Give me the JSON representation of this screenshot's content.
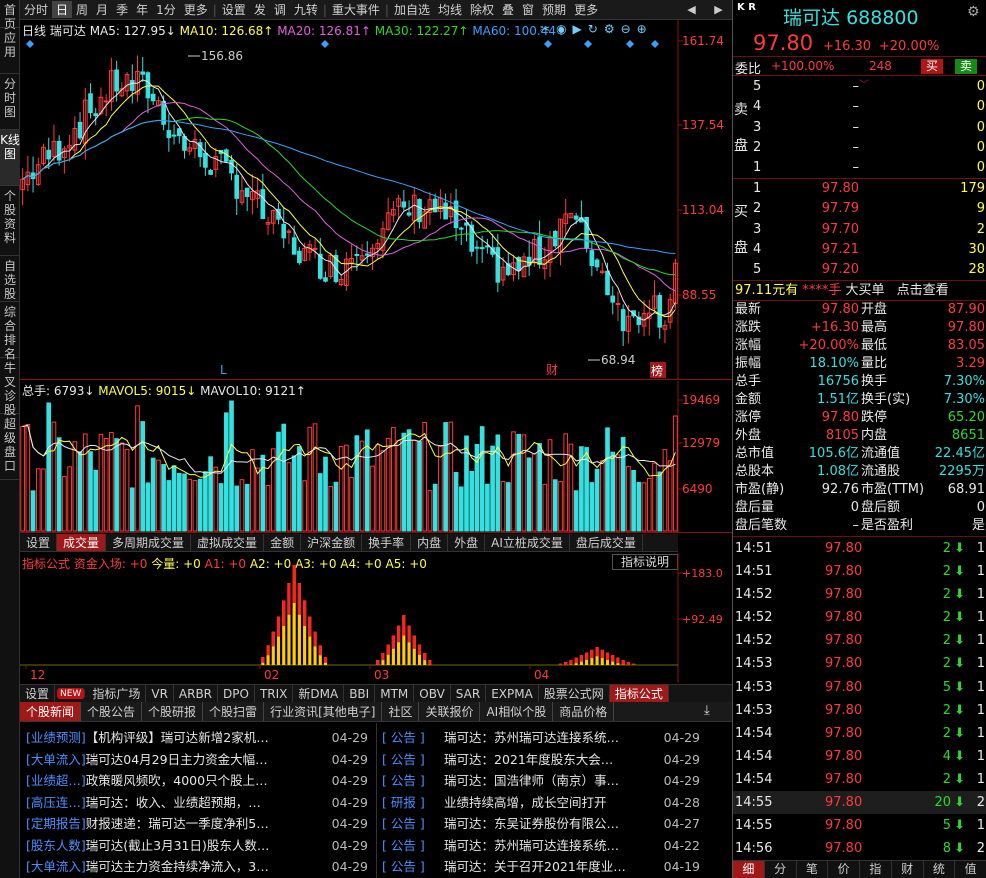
{
  "left_tabs": [
    "首页",
    "应用",
    "分时图",
    "K线图",
    "个股资料",
    "自选股",
    "综合排名",
    "牛叉诊股",
    "超级盘口"
  ],
  "left_active": "K线图",
  "toolbar": {
    "items": [
      "分时",
      "日",
      "周",
      "月",
      "季",
      "年",
      "1分",
      "更多",
      "设置",
      "发",
      "调",
      "九转",
      "重大事件",
      "加自选",
      "均线",
      "除权",
      "叠",
      "窗",
      "预期",
      "更多"
    ],
    "active": "日"
  },
  "kline": {
    "label_day": "日线",
    "name": "瑞可达",
    "ma5": "MA5: 127.95↓",
    "ma10": "MA10: 126.68↑",
    "ma20": "MA20: 126.81↑",
    "ma30": "MA30: 122.27↑",
    "ma60": "MA60: 100.44↑",
    "y_ticks": [
      "161.74",
      "137.54",
      "113.04",
      "88.55"
    ],
    "high_label": "156.86",
    "low_label": "68.94",
    "marker_L": "L",
    "marker_cai": "财",
    "marker_bang": "榜"
  },
  "volume": {
    "total": "总手: 6793↓",
    "mavol5": "MAVOL5: 9015↓",
    "mavol10": "MAVOL10: 9121↑",
    "y_ticks": [
      "19469",
      "12979",
      "6490"
    ]
  },
  "vol_tabs": [
    "设置",
    "成交量",
    "多周期成交量",
    "虚拟成交量",
    "金额",
    "沪深金额",
    "换手率",
    "内盘",
    "外盘",
    "AI立桩成交量",
    "盘后成交量"
  ],
  "vol_tabs_active": "成交量",
  "indicator": {
    "title": "指标公式",
    "formula": "资金入场: +0",
    "today": "今量: +0",
    "a1": "A1: +0",
    "a2": "A2: +0",
    "a3": "A3: +0",
    "a4": "A4: +0",
    "a5": "A5: +0",
    "help": "指标说明",
    "y_ticks": [
      "+183.0",
      "+92.49"
    ],
    "x_labels": [
      "12",
      "02",
      "03",
      "04"
    ]
  },
  "ind_tabs": [
    "设置",
    "NEW",
    "指标广场",
    "VR",
    "ARBR",
    "DPO",
    "TRIX",
    "新DMA",
    "BBI",
    "MTM",
    "OBV",
    "SAR",
    "EXPMA",
    "股票公式网",
    "指标公式"
  ],
  "ind_tabs_active": "指标公式",
  "news_tabs": [
    "个股新闻",
    "个股公告",
    "个股研报",
    "个股扫雷",
    "行业资讯[其他电子]",
    "社区",
    "关联报价",
    "AI相似个股",
    "商品价格"
  ],
  "news_tabs_active": "个股新闻",
  "news_left": [
    {
      "tag": "[业绩预测]",
      "title": "【机构评级】瑞可达新增2家机…",
      "date": "04-29"
    },
    {
      "tag": "[大单流入]",
      "title": "瑞可达04月29日主力资金大幅…",
      "date": "04-29"
    },
    {
      "tag": "[业绩超…]",
      "title": "政策暖风频吹，4000只个股上…",
      "date": "04-29"
    },
    {
      "tag": "[高压连…]",
      "title": "瑞可达：收入、业绩超预期，…",
      "date": "04-29"
    },
    {
      "tag": "[定期报告]",
      "title": "财报速递：瑞可达一季度净利5…",
      "date": "04-29"
    },
    {
      "tag": "[股东人数]",
      "title": "瑞可达(截止3月31日)股东人数…",
      "date": "04-29"
    },
    {
      "tag": "[大单流入]",
      "title": "瑞可达主力资金持续净流入，3…",
      "date": "04-29"
    }
  ],
  "news_right": [
    {
      "tag": "公告",
      "title": "瑞可达：苏州瑞可达连接系统…",
      "date": "04-29"
    },
    {
      "tag": "公告",
      "title": "瑞可达：2021年度股东大会…",
      "date": "04-29"
    },
    {
      "tag": "公告",
      "title": "瑞可达：国浩律师（南京）事…",
      "date": "04-29"
    },
    {
      "tag": "研报",
      "title": "业绩持续高增，成长空间打开",
      "date": "04-28"
    },
    {
      "tag": "公告",
      "title": "瑞可达：东吴证券股份有限公…",
      "date": "04-27"
    },
    {
      "tag": "公告",
      "title": "瑞可达：苏州瑞可达连接系统…",
      "date": "04-22"
    },
    {
      "tag": "公告",
      "title": "瑞可达：关于召开2021年度业…",
      "date": "04-19"
    }
  ],
  "quote": {
    "kr": "K R",
    "name": "瑞可达",
    "code": "688800",
    "price": "97.80",
    "change": "+16.30",
    "pct": "+20.00%",
    "weibi_label": "委比",
    "weibi": "+100.00%",
    "weicha": "248",
    "buy_btn": "买",
    "sell_btn": "卖",
    "sell_label": "卖盘",
    "buy_label": "买盘",
    "asks": [
      {
        "lvl": "5",
        "price": "–",
        "vol": "0"
      },
      {
        "lvl": "4",
        "price": "–",
        "vol": "0"
      },
      {
        "lvl": "3",
        "price": "–",
        "vol": "0"
      },
      {
        "lvl": "2",
        "price": "–",
        "vol": "0"
      },
      {
        "lvl": "1",
        "price": "–",
        "vol": "0"
      }
    ],
    "bids": [
      {
        "lvl": "1",
        "price": "97.80",
        "vol": "179"
      },
      {
        "lvl": "2",
        "price": "97.79",
        "vol": "9"
      },
      {
        "lvl": "3",
        "price": "97.70",
        "vol": "2"
      },
      {
        "lvl": "4",
        "price": "97.21",
        "vol": "30"
      },
      {
        "lvl": "5",
        "price": "97.20",
        "vol": "28"
      }
    ],
    "bigorder": {
      "price": "97.11元有",
      "mask": "****手",
      "label": "大买单",
      "link": "点击查看"
    },
    "stats": [
      {
        "l1": "最新",
        "v1": "97.80",
        "c1": "red",
        "l2": "开盘",
        "v2": "87.90",
        "c2": "red"
      },
      {
        "l1": "涨跌",
        "v1": "+16.30",
        "c1": "red",
        "l2": "最高",
        "v2": "97.80",
        "c2": "red"
      },
      {
        "l1": "涨幅",
        "v1": "+20.00%",
        "c1": "red",
        "l2": "最低",
        "v2": "83.05",
        "c2": "red"
      },
      {
        "l1": "振幅",
        "v1": "18.10%",
        "c1": "cyan",
        "l2": "量比",
        "v2": "3.29",
        "c2": "red"
      },
      {
        "l1": "总手",
        "v1": "16756",
        "c1": "cyan",
        "l2": "换手",
        "v2": "7.30%",
        "c2": "cyan"
      },
      {
        "l1": "金额",
        "v1": "1.51亿",
        "c1": "cyan",
        "l2": "换手(实)",
        "v2": "7.30%",
        "c2": "cyan"
      },
      {
        "l1": "涨停",
        "v1": "97.80",
        "c1": "red",
        "l2": "跌停",
        "v2": "65.20",
        "c2": "green"
      },
      {
        "l1": "外盘",
        "v1": "8105",
        "c1": "red",
        "l2": "内盘",
        "v2": "8651",
        "c2": "green"
      },
      {
        "l1": "总市值",
        "v1": "105.6亿",
        "c1": "cyan",
        "l2": "流通值",
        "v2": "22.45亿",
        "c2": "cyan"
      },
      {
        "l1": "总股本",
        "v1": "1.08亿",
        "c1": "cyan",
        "l2": "流通股",
        "v2": "2295万",
        "c2": "cyan"
      },
      {
        "l1": "市盈(静)",
        "v1": "92.76",
        "c1": "white",
        "l2": "市盈(TTM)",
        "v2": "68.91",
        "c2": "white"
      },
      {
        "l1": "盘后量",
        "v1": "0",
        "c1": "white",
        "l2": "盘后额",
        "v2": "0",
        "c2": "white"
      },
      {
        "l1": "盘后笔数",
        "v1": "–",
        "c1": "white",
        "l2": "是否盈利",
        "v2": "是",
        "c2": "white"
      }
    ],
    "ticks": [
      {
        "t": "14:51",
        "p": "97.80",
        "v": "2",
        "n": "1"
      },
      {
        "t": "14:51",
        "p": "97.80",
        "v": "2",
        "n": "1"
      },
      {
        "t": "14:52",
        "p": "97.80",
        "v": "2",
        "n": "1"
      },
      {
        "t": "14:52",
        "p": "97.80",
        "v": "2",
        "n": "1"
      },
      {
        "t": "14:52",
        "p": "97.80",
        "v": "2",
        "n": "1"
      },
      {
        "t": "14:53",
        "p": "97.80",
        "v": "2",
        "n": "1"
      },
      {
        "t": "14:53",
        "p": "97.80",
        "v": "5",
        "n": "1"
      },
      {
        "t": "14:53",
        "p": "97.80",
        "v": "2",
        "n": "1"
      },
      {
        "t": "14:54",
        "p": "97.80",
        "v": "2",
        "n": "1"
      },
      {
        "t": "14:54",
        "p": "97.80",
        "v": "4",
        "n": "1"
      },
      {
        "t": "14:54",
        "p": "97.80",
        "v": "2",
        "n": "1"
      },
      {
        "t": "14:55",
        "p": "97.80",
        "v": "20",
        "n": "2"
      },
      {
        "t": "14:55",
        "p": "97.80",
        "v": "5",
        "n": "1"
      },
      {
        "t": "14:56",
        "p": "97.80",
        "v": "8",
        "n": "2"
      }
    ],
    "bottom_tabs": [
      "细",
      "分",
      "笔",
      "价",
      "指",
      "财",
      "统",
      "值"
    ],
    "bottom_active": "细"
  }
}
